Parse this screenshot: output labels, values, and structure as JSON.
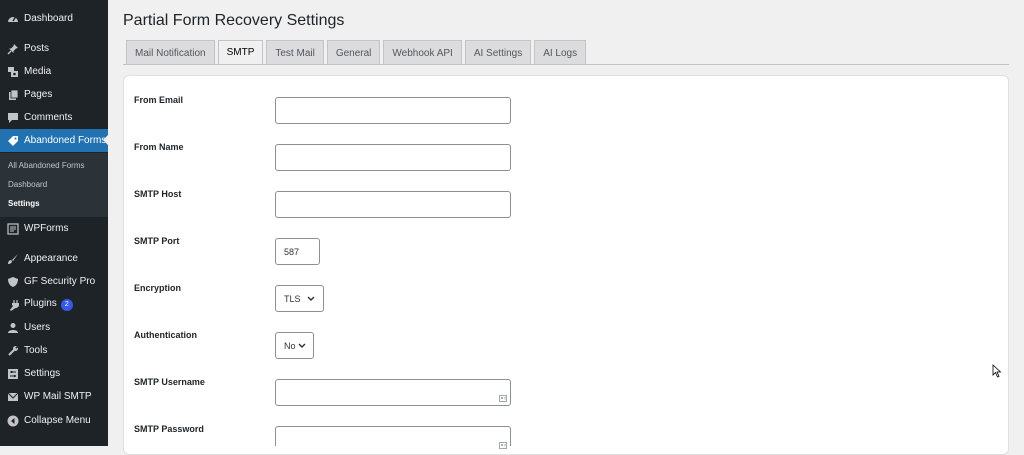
{
  "sidebar": {
    "items": [
      {
        "label": "Dashboard",
        "icon": "dashboard-icon"
      },
      {
        "label": "Posts",
        "icon": "pin-icon"
      },
      {
        "label": "Media",
        "icon": "media-icon"
      },
      {
        "label": "Pages",
        "icon": "pages-icon"
      },
      {
        "label": "Comments",
        "icon": "comments-icon"
      },
      {
        "label": "Abandoned Forms",
        "icon": "tag-icon"
      },
      {
        "label": "WPForms",
        "icon": "wpforms-icon"
      },
      {
        "label": "Appearance",
        "icon": "brush-icon"
      },
      {
        "label": "GF Security Pro",
        "icon": "shield-icon"
      },
      {
        "label": "Plugins",
        "icon": "plugin-icon",
        "badge": "2"
      },
      {
        "label": "Users",
        "icon": "users-icon"
      },
      {
        "label": "Tools",
        "icon": "wrench-icon"
      },
      {
        "label": "Settings",
        "icon": "settings-icon"
      },
      {
        "label": "WP Mail SMTP",
        "icon": "mail-icon"
      },
      {
        "label": "Collapse Menu",
        "icon": "collapse-icon"
      }
    ],
    "submenu": [
      "All Abandoned Forms",
      "Dashboard",
      "Settings"
    ]
  },
  "page": {
    "title": "Partial Form Recovery Settings"
  },
  "tabs": [
    "Mail Notification",
    "SMTP",
    "Test Mail",
    "General",
    "Webhook API",
    "AI Settings",
    "AI Logs"
  ],
  "active_tab": "SMTP",
  "form": {
    "from_email": {
      "label": "From Email",
      "value": ""
    },
    "from_name": {
      "label": "From Name",
      "value": ""
    },
    "smtp_host": {
      "label": "SMTP Host",
      "value": ""
    },
    "smtp_port": {
      "label": "SMTP Port",
      "value": "587"
    },
    "encryption": {
      "label": "Encryption",
      "value": "TLS"
    },
    "authentication": {
      "label": "Authentication",
      "value": "No"
    },
    "smtp_username": {
      "label": "SMTP Username",
      "value": ""
    },
    "smtp_password": {
      "label": "SMTP Password",
      "value": ""
    }
  },
  "colors": {
    "sidebar_bg": "#1d2327",
    "accent": "#2271b1",
    "badge": "#3858e9"
  }
}
